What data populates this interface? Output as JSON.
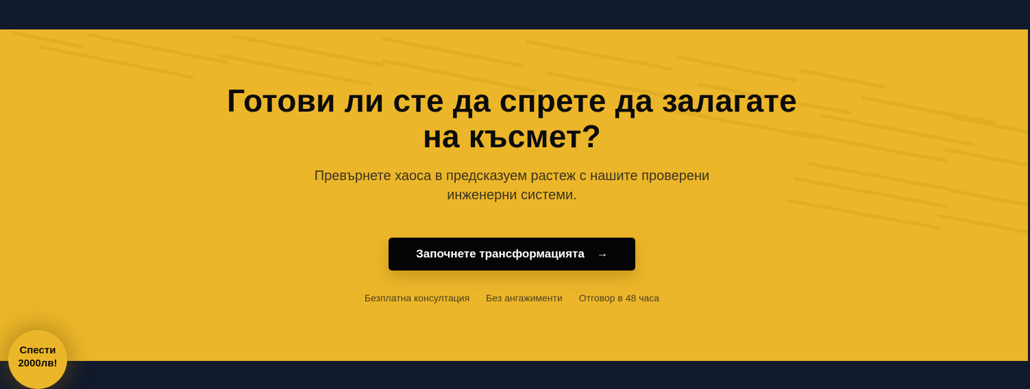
{
  "cta": {
    "headline_line1": "Готови ли сте да спрете да залагате",
    "headline_line2": "на късмет?",
    "subhead_line1": "Превърнете хаоса в предсказуем растеж с нашите проверени",
    "subhead_line2": "инженерни системи.",
    "button_label": "Започнете трансформацията",
    "button_icon": "arrow-right-icon",
    "trust_items": [
      "Безплатна консултация",
      "Без ангажименти",
      "Отговор в 48 часа"
    ]
  },
  "badge": {
    "line1": "Спести",
    "line2": "2000лв!"
  },
  "colors": {
    "accent": "#ecb62a",
    "dark": "#111a2c",
    "button": "#050505"
  }
}
